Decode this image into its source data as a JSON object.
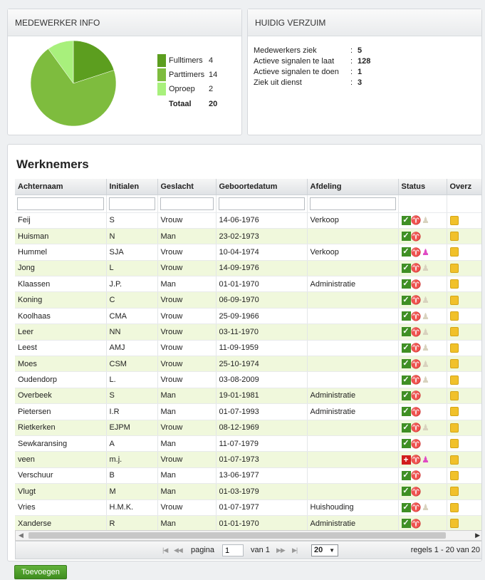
{
  "info_panel": {
    "title": "MEDEWERKER INFO",
    "chart_data": {
      "type": "pie",
      "categories": [
        "Fulltimers",
        "Parttimers",
        "Oproep"
      ],
      "values": [
        4,
        14,
        2
      ],
      "colors": [
        "#5c9e1f",
        "#7ebc3e",
        "#a8f07c"
      ]
    },
    "legend": [
      {
        "label": "Fulltimers",
        "count": "4",
        "color": "#5c9e1f"
      },
      {
        "label": "Parttimers",
        "count": "14",
        "color": "#7ebc3e"
      },
      {
        "label": "Oproep",
        "count": "2",
        "color": "#a8f07c"
      }
    ],
    "total_label": "Totaal",
    "total_value": "20"
  },
  "verzuim_panel": {
    "title": "HUIDIG VERZUIM",
    "rows": [
      {
        "label": "Medewerkers ziek",
        "value": "5"
      },
      {
        "label": "Actieve signalen te laat",
        "value": "128"
      },
      {
        "label": "Actieve signalen te doen",
        "value": "1"
      },
      {
        "label": "Ziek uit dienst",
        "value": "3"
      }
    ]
  },
  "employees": {
    "title": "Werknemers",
    "columns": [
      "Achternaam",
      "Initialen",
      "Geslacht",
      "Geboortedatum",
      "Afdeling",
      "Status",
      "Overz"
    ],
    "rows": [
      {
        "name": "Feij",
        "initials": "S",
        "gender": "Vrouw",
        "birthdate": "14-06-1976",
        "department": "Verkoop",
        "status": "check",
        "extra": "person-faded"
      },
      {
        "name": "Huisman",
        "initials": "N",
        "gender": "Man",
        "birthdate": "23-02-1973",
        "department": "",
        "status": "check",
        "extra": ""
      },
      {
        "name": "Hummel",
        "initials": "SJA",
        "gender": "Vrouw",
        "birthdate": "10-04-1974",
        "department": "Verkoop",
        "status": "check",
        "extra": "person-pink"
      },
      {
        "name": "Jong",
        "initials": "L",
        "gender": "Vrouw",
        "birthdate": "14-09-1976",
        "department": "",
        "status": "check",
        "extra": "person-faded"
      },
      {
        "name": "Klaassen",
        "initials": "J.P.",
        "gender": "Man",
        "birthdate": "01-01-1970",
        "department": "Administratie",
        "status": "check",
        "extra": ""
      },
      {
        "name": "Koning",
        "initials": "C",
        "gender": "Vrouw",
        "birthdate": "06-09-1970",
        "department": "",
        "status": "check",
        "extra": "person-faded"
      },
      {
        "name": "Koolhaas",
        "initials": "CMA",
        "gender": "Vrouw",
        "birthdate": "25-09-1966",
        "department": "",
        "status": "check",
        "extra": "person-faded"
      },
      {
        "name": "Leer",
        "initials": "NN",
        "gender": "Vrouw",
        "birthdate": "03-11-1970",
        "department": "",
        "status": "check",
        "extra": "person-faded"
      },
      {
        "name": "Leest",
        "initials": "AMJ",
        "gender": "Vrouw",
        "birthdate": "11-09-1959",
        "department": "",
        "status": "check",
        "extra": "person-faded"
      },
      {
        "name": "Moes",
        "initials": "CSM",
        "gender": "Vrouw",
        "birthdate": "25-10-1974",
        "department": "",
        "status": "check",
        "extra": "person-faded"
      },
      {
        "name": "Oudendorp",
        "initials": "L.",
        "gender": "Vrouw",
        "birthdate": "03-08-2009",
        "department": "",
        "status": "check",
        "extra": "person-faded"
      },
      {
        "name": "Overbeek",
        "initials": "S",
        "gender": "Man",
        "birthdate": "19-01-1981",
        "department": "Administratie",
        "status": "check",
        "extra": ""
      },
      {
        "name": "Pietersen",
        "initials": "I.R",
        "gender": "Man",
        "birthdate": "01-07-1993",
        "department": "Administratie",
        "status": "check",
        "extra": ""
      },
      {
        "name": "Rietkerken",
        "initials": "EJPM",
        "gender": "Vrouw",
        "birthdate": "08-12-1969",
        "department": "",
        "status": "check",
        "extra": "person-faded"
      },
      {
        "name": "Sewkaransing",
        "initials": "A",
        "gender": "Man",
        "birthdate": "11-07-1979",
        "department": "",
        "status": "check",
        "extra": ""
      },
      {
        "name": "veen",
        "initials": "m.j.",
        "gender": "Vrouw",
        "birthdate": "01-07-1973",
        "department": "",
        "status": "cross",
        "extra": "person-pink"
      },
      {
        "name": "Verschuur",
        "initials": "B",
        "gender": "Man",
        "birthdate": "13-06-1977",
        "department": "",
        "status": "check",
        "extra": ""
      },
      {
        "name": "Vlugt",
        "initials": "M",
        "gender": "Man",
        "birthdate": "01-03-1979",
        "department": "",
        "status": "check",
        "extra": ""
      },
      {
        "name": "Vries",
        "initials": "H.M.K.",
        "gender": "Vrouw",
        "birthdate": "01-07-1977",
        "department": "Huishouding",
        "status": "check",
        "extra": "person-faded"
      },
      {
        "name": "Xanderse",
        "initials": "R",
        "gender": "Man",
        "birthdate": "01-01-1970",
        "department": "Administratie",
        "status": "check",
        "extra": ""
      }
    ]
  },
  "pager": {
    "nav_first": "|◀",
    "nav_prev": "◀◀",
    "nav_next": "▶▶",
    "nav_last": "▶|",
    "page_label": "pagina",
    "page_value": "1",
    "of_label": "van 1",
    "page_size": "20",
    "summary": "regels 1 - 20 van 20"
  },
  "add_button_label": "Toevoegen",
  "colors": {
    "accent": "#3e8d1f",
    "row_alt": "#f0f8dc"
  }
}
